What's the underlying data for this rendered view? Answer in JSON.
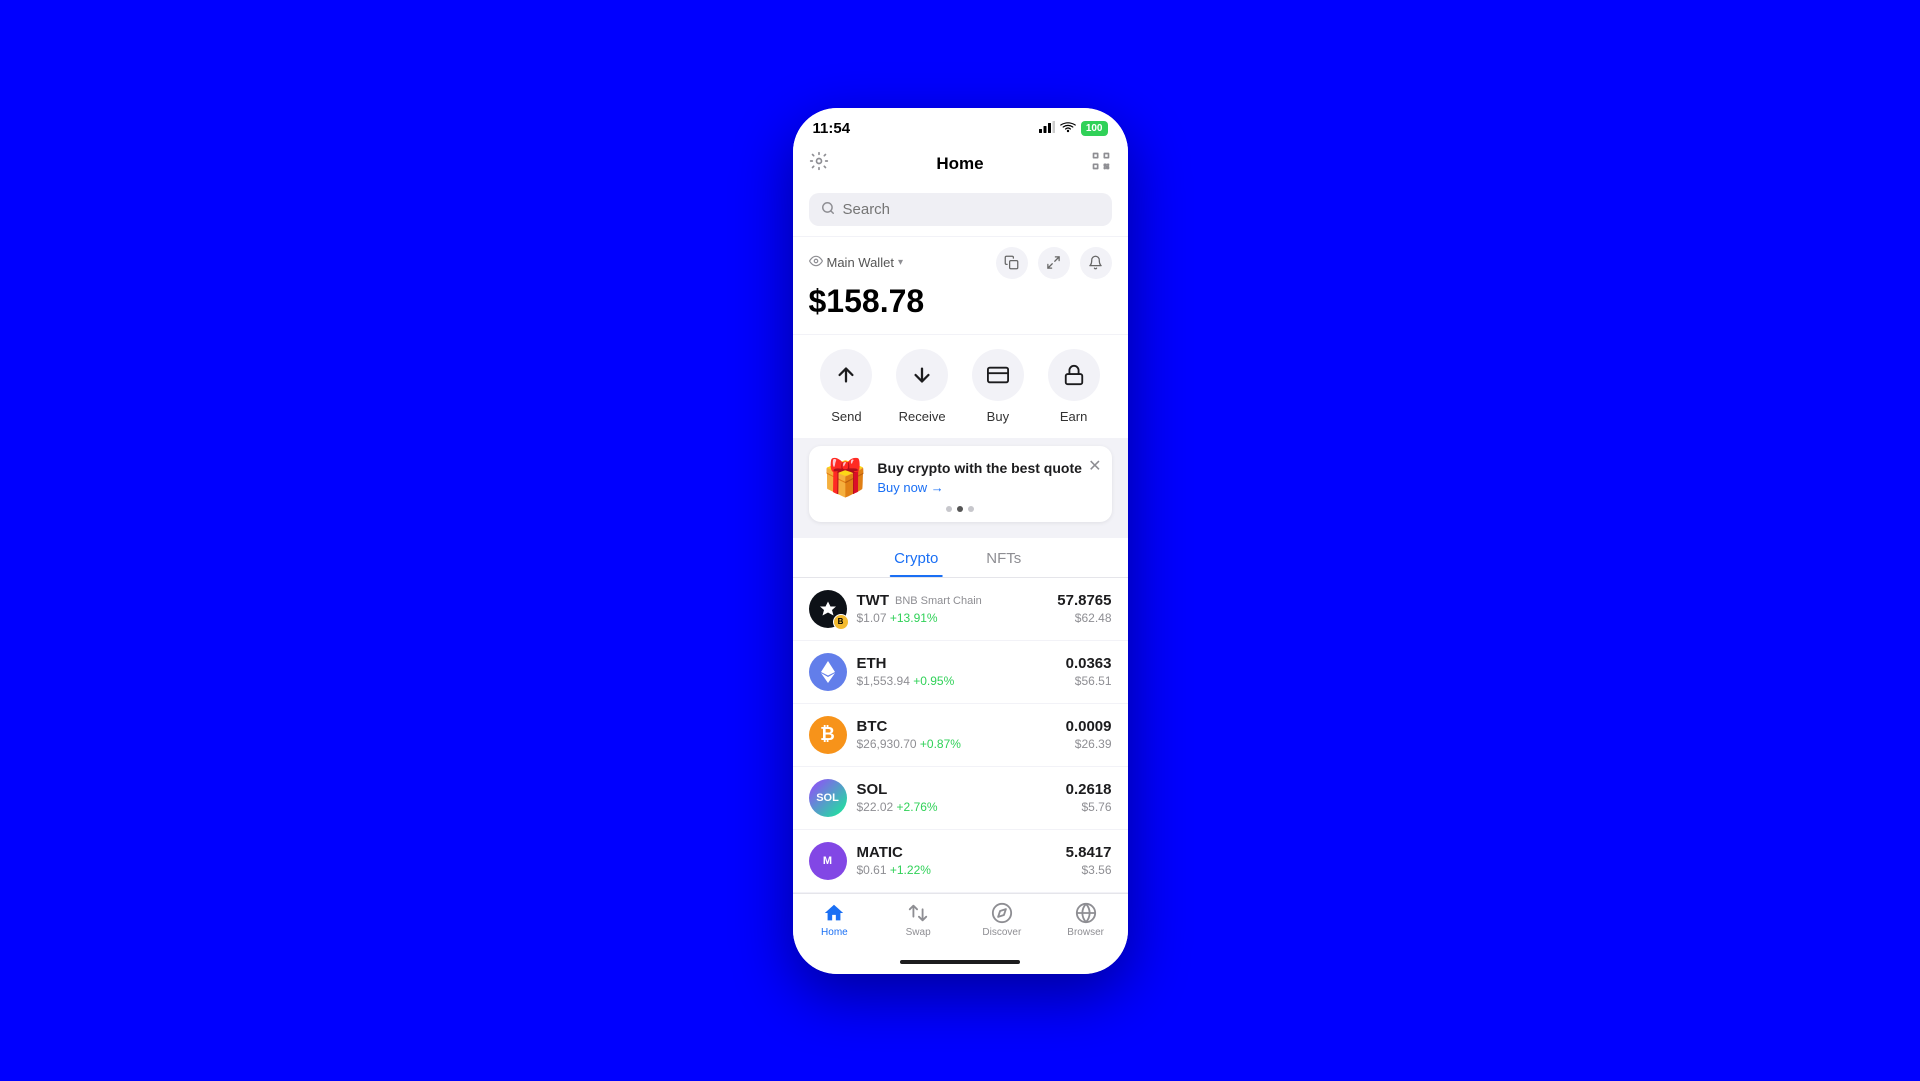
{
  "status": {
    "time": "11:54",
    "battery": "100",
    "signal": "▲▲▲",
    "wifi": "wifi"
  },
  "header": {
    "title": "Home",
    "left_icon": "settings",
    "right_icon": "scan"
  },
  "search": {
    "placeholder": "Search"
  },
  "wallet": {
    "name": "Main Wallet",
    "balance": "$158.78",
    "actions": [
      "copy",
      "expand",
      "bell"
    ]
  },
  "action_buttons": [
    {
      "id": "send",
      "label": "Send",
      "icon": "↑"
    },
    {
      "id": "receive",
      "label": "Receive",
      "icon": "↓"
    },
    {
      "id": "buy",
      "label": "Buy",
      "icon": "card"
    },
    {
      "id": "earn",
      "label": "Earn",
      "icon": "lock"
    }
  ],
  "promo": {
    "title": "Buy crypto with the best quote",
    "cta": "Buy now →",
    "emoji": "🎁"
  },
  "tabs": [
    {
      "id": "crypto",
      "label": "Crypto",
      "active": true
    },
    {
      "id": "nfts",
      "label": "NFTs",
      "active": false
    }
  ],
  "crypto_list": [
    {
      "symbol": "TWT",
      "chain": "BNB Smart Chain",
      "price": "$1.07",
      "change": "+13.91%",
      "change_positive": true,
      "amount": "57.8765",
      "value": "$62.48",
      "color_class": "twt",
      "has_chain_badge": true
    },
    {
      "symbol": "ETH",
      "chain": "",
      "price": "$1,553.94",
      "change": "+0.95%",
      "change_positive": true,
      "amount": "0.0363",
      "value": "$56.51",
      "color_class": "eth",
      "has_chain_badge": false
    },
    {
      "symbol": "BTC",
      "chain": "",
      "price": "$26,930.70",
      "change": "+0.87%",
      "change_positive": true,
      "amount": "0.0009",
      "value": "$26.39",
      "color_class": "btc",
      "has_chain_badge": false
    },
    {
      "symbol": "SOL",
      "chain": "",
      "price": "$22.02",
      "change": "+2.76%",
      "change_positive": true,
      "amount": "0.2618",
      "value": "$5.76",
      "color_class": "sol",
      "has_chain_badge": false
    },
    {
      "symbol": "MATIC",
      "chain": "",
      "price": "$0.61",
      "change": "+1.22%",
      "change_positive": true,
      "amount": "5.8417",
      "value": "$3.56",
      "color_class": "matic",
      "has_chain_badge": false
    }
  ],
  "bottom_nav": [
    {
      "id": "home",
      "label": "Home",
      "active": true
    },
    {
      "id": "swap",
      "label": "Swap",
      "active": false
    },
    {
      "id": "discover",
      "label": "Discover",
      "active": false
    },
    {
      "id": "browser",
      "label": "Browser",
      "active": false
    }
  ],
  "dots": [
    false,
    true,
    false
  ]
}
